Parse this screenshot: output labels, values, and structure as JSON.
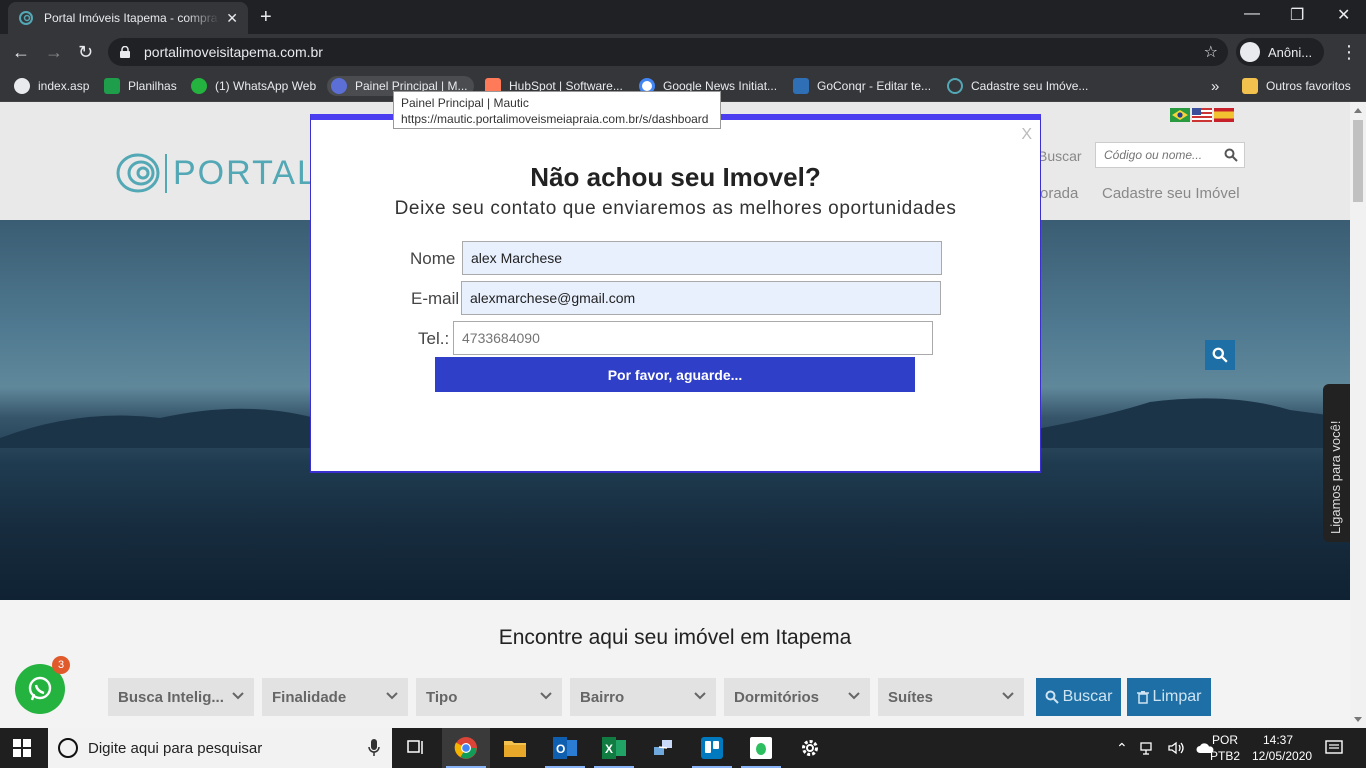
{
  "browser": {
    "tab_title": "Portal Imóveis Itapema - compra",
    "url": "portalimoveisitapema.com.br",
    "profile_name": "Anôni...",
    "bookmarks": [
      {
        "label": "index.asp"
      },
      {
        "label": "Planilhas"
      },
      {
        "label": "(1) WhatsApp Web"
      },
      {
        "label": "Painel Principal | M..."
      },
      {
        "label": "HubSpot | Software..."
      },
      {
        "label": "Google News Initiat..."
      },
      {
        "label": "GoConqr - Editar te..."
      },
      {
        "label": "Cadastre seu Imóve..."
      }
    ],
    "more_bookmarks": "»",
    "other_bookmarks": "Outros favoritos",
    "tooltip": {
      "title": "Painel Principal | Mautic",
      "url": "https://mautic.portalimoveismeiapraia.com.br/s/dashboard"
    }
  },
  "site": {
    "logo_text": "PORTALIM",
    "buscar_label": "Buscar",
    "code_search_placeholder": "Código ou nome...",
    "nav": {
      "partial": "orada",
      "register": "Cadastre seu Imóvel"
    },
    "side_tab": "Ligamos para você!",
    "find_title": "Encontre aqui seu imóvel em Itapema",
    "filters": [
      "Busca Intelig...",
      "Finalidade",
      "Tipo",
      "Bairro",
      "Dormitórios",
      "Suítes"
    ],
    "search_button": "Buscar",
    "clear_button": "Limpar",
    "whatsapp_badge": "3"
  },
  "modal": {
    "close": "X",
    "title": "Não achou seu Imovel?",
    "subtitle": "Deixe seu contato que enviaremos as melhores oportunidades",
    "fields": {
      "name_label": "Nome",
      "name_value": "alex Marchese",
      "email_label": "E-mail",
      "email_value": "alexmarchese@gmail.com",
      "phone_label": "Tel.:",
      "phone_placeholder": "4733684090"
    },
    "submit": "Por favor, aguarde..."
  },
  "taskbar": {
    "search_placeholder": "Digite aqui para pesquisar",
    "lang_top": "POR",
    "lang_bottom": "PTB2",
    "time": "14:37",
    "date": "12/05/2020"
  },
  "colors": {
    "modal_accent": "#4b3df0",
    "submit_bg": "#2f3fc8",
    "site_blue": "#1d6fa5",
    "whatsapp_green": "#25b340"
  }
}
